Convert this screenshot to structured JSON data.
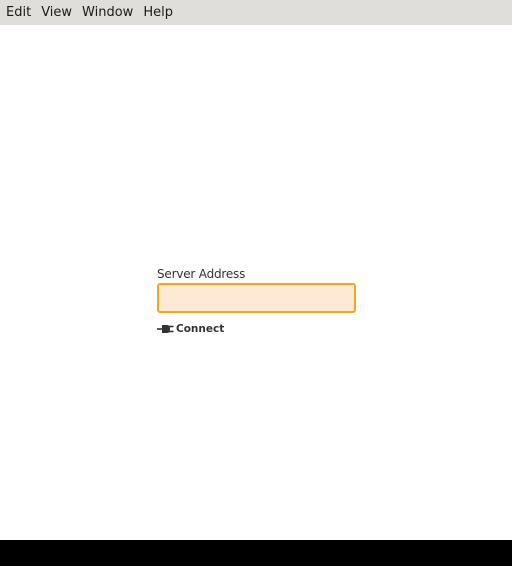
{
  "menubar": {
    "items": [
      {
        "label": "Edit"
      },
      {
        "label": "View"
      },
      {
        "label": "Window"
      },
      {
        "label": "Help"
      }
    ]
  },
  "form": {
    "server_address_label": "Server Address",
    "server_address_value": "",
    "server_address_placeholder": "",
    "connect_label": "Connect",
    "connect_icon": "plug-icon"
  },
  "colors": {
    "input_background": "#feead4",
    "input_border": "#f5a623",
    "menubar_background": "#dfdedb"
  }
}
